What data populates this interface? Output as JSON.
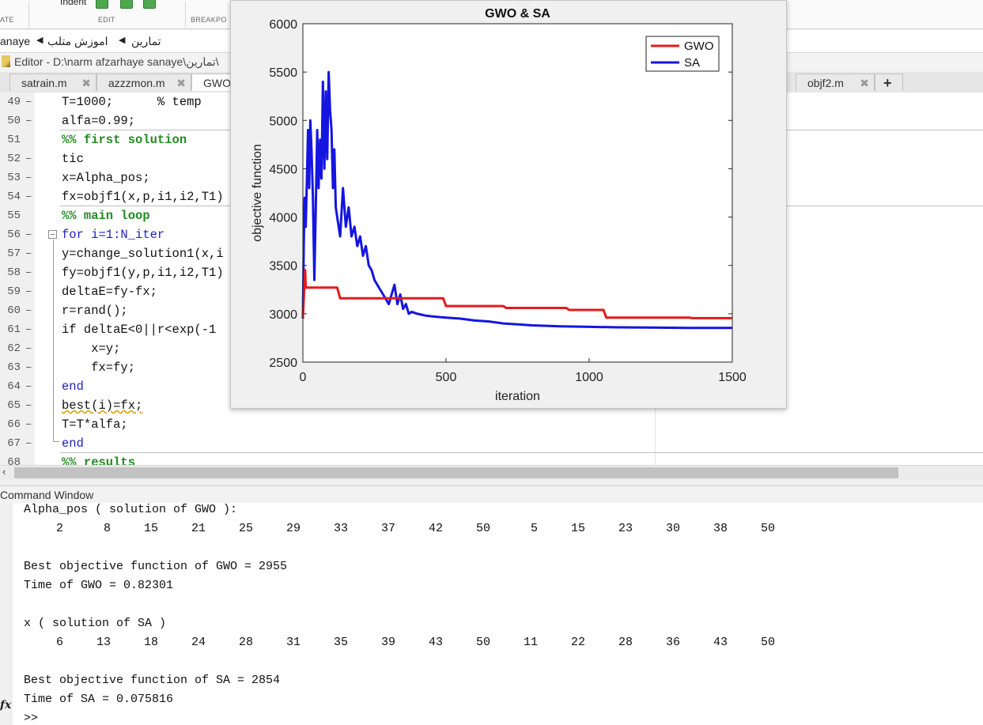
{
  "toolstrip": {
    "items": [
      {
        "label": "Indent"
      },
      {
        "label": "ATE"
      },
      {
        "label": "EDIT"
      },
      {
        "label": "BREAKPO"
      }
    ]
  },
  "address": {
    "segments": [
      "anaye",
      "اموزش متلب",
      "تمارین"
    ]
  },
  "editor": {
    "title": "Editor - D:\\narm afzarhaye sanaye\\تمارین\\",
    "tabs": [
      {
        "label": "satrain.m"
      },
      {
        "label": "azzzmon.m"
      },
      {
        "label": "GWO"
      },
      {
        "label": "objf2.m"
      }
    ],
    "add_tab": "+",
    "lines": [
      {
        "num": "49",
        "code": "T=1000;      % temp"
      },
      {
        "num": "50",
        "code": "alfa=0.99;"
      },
      {
        "num": "51",
        "code": "%% first solution"
      },
      {
        "num": "52",
        "code": "tic"
      },
      {
        "num": "53",
        "code": "x=Alpha_pos;"
      },
      {
        "num": "54",
        "code": "fx=objf1(x,p,i1,i2,T1)"
      },
      {
        "num": "55",
        "code": "%% main loop"
      },
      {
        "num": "56",
        "code": "for i=1:N_iter"
      },
      {
        "num": "57",
        "code": "y=change_solution1(x,i"
      },
      {
        "num": "58",
        "code": "fy=objf1(y,p,i1,i2,T1)"
      },
      {
        "num": "59",
        "code": "deltaE=fy-fx;"
      },
      {
        "num": "60",
        "code": "r=rand();"
      },
      {
        "num": "61",
        "code": "if deltaE<0||r<exp(-1"
      },
      {
        "num": "62",
        "code": "    x=y;"
      },
      {
        "num": "63",
        "code": "    fx=fy;"
      },
      {
        "num": "64",
        "code": "end"
      },
      {
        "num": "65",
        "code": "best(i)=fx;"
      },
      {
        "num": "66",
        "code": "T=T*alfa;"
      },
      {
        "num": "67",
        "code": "end"
      },
      {
        "num": "68",
        "code": "%% results"
      }
    ]
  },
  "command_window": {
    "title": "Command Window",
    "lines": [
      "Alpha_pos ( solution of GWO ):",
      "Best objective function of GWO = 2955",
      "Time of GWO = 0.82301",
      "x ( solution of SA )",
      "Best objective function of SA = 2854",
      "Time of SA = 0.075816"
    ],
    "alpha_pos_values": [
      "2",
      "8",
      "15",
      "21",
      "25",
      "29",
      "33",
      "37",
      "42",
      "50",
      "5",
      "15",
      "23",
      "30",
      "38",
      "50"
    ],
    "sa_values": [
      "6",
      "13",
      "18",
      "24",
      "28",
      "31",
      "35",
      "39",
      "43",
      "50",
      "11",
      "22",
      "28",
      "36",
      "43",
      "50"
    ],
    "fx_label": "fx",
    "prompt": ">>"
  },
  "chart_data": {
    "type": "line",
    "title": "GWO & SA",
    "xlabel": "iteration",
    "ylabel": "objective function",
    "xlim": [
      0,
      1500
    ],
    "ylim": [
      2500,
      6000
    ],
    "xticks": [
      "0",
      "500",
      "1000",
      "1500"
    ],
    "yticks": [
      "2500",
      "3000",
      "3500",
      "4000",
      "4500",
      "5000",
      "5500",
      "6000"
    ],
    "legend_position": "top-right",
    "series": [
      {
        "name": "GWO",
        "color": "#e41a1c",
        "x": [
          0,
          8,
          10,
          120,
          130,
          490,
          500,
          700,
          710,
          920,
          930,
          1050,
          1060,
          1350,
          1360,
          1500
        ],
        "y": [
          2960,
          3450,
          3270,
          3270,
          3160,
          3160,
          3080,
          3080,
          3060,
          3060,
          3040,
          3040,
          2960,
          2960,
          2955,
          2955
        ]
      },
      {
        "name": "SA",
        "color": "#1515e0",
        "x": [
          0,
          3,
          6,
          10,
          14,
          18,
          22,
          26,
          30,
          35,
          40,
          45,
          50,
          55,
          60,
          65,
          70,
          75,
          80,
          85,
          90,
          95,
          100,
          105,
          110,
          115,
          120,
          130,
          140,
          150,
          160,
          170,
          180,
          190,
          200,
          210,
          220,
          230,
          240,
          250,
          260,
          270,
          280,
          290,
          300,
          310,
          320,
          330,
          340,
          350,
          360,
          370,
          380,
          400,
          430,
          460,
          500,
          550,
          600,
          650,
          700,
          750,
          800,
          900,
          1000,
          1100,
          1200,
          1350,
          1500
        ],
        "y": [
          2950,
          3700,
          4200,
          3900,
          4400,
          4900,
          4300,
          5000,
          4700,
          4200,
          3350,
          4100,
          4900,
          4300,
          4800,
          4400,
          5400,
          4500,
          5300,
          4600,
          5500,
          5100,
          4900,
          4300,
          4700,
          4100,
          4000,
          3800,
          4300,
          3900,
          4100,
          3800,
          3900,
          3700,
          3800,
          3600,
          3700,
          3500,
          3450,
          3350,
          3300,
          3250,
          3200,
          3150,
          3100,
          3200,
          3300,
          3100,
          3200,
          3050,
          3100,
          3000,
          3020,
          3000,
          2980,
          2970,
          2960,
          2950,
          2930,
          2920,
          2900,
          2890,
          2880,
          2870,
          2865,
          2860,
          2858,
          2854,
          2854
        ]
      }
    ]
  }
}
